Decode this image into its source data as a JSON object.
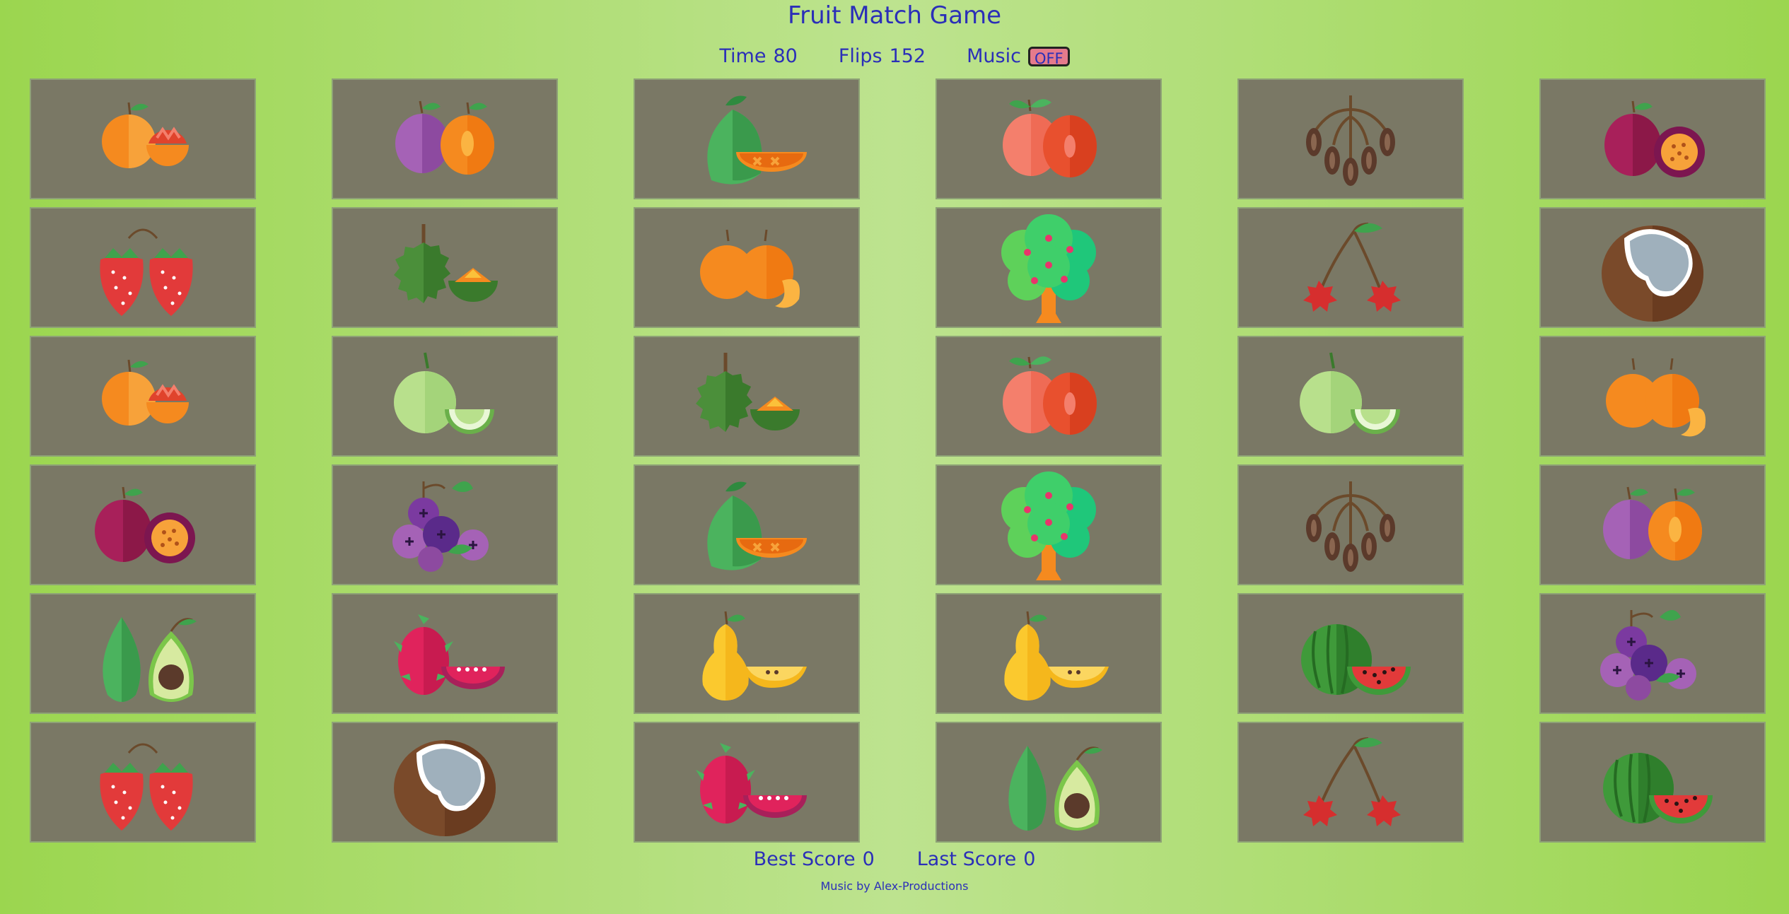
{
  "header": {
    "title": "Fruit Match Game"
  },
  "stats": {
    "time_label": "Time",
    "time_value": "80",
    "flips_label": "Flips",
    "flips_value": "152",
    "music_label": "Music",
    "music_button": "OFF"
  },
  "board": {
    "rows": [
      [
        "orange",
        "plum",
        "mango",
        "apple",
        "dates",
        "passion-fruit"
      ],
      [
        "strawberry",
        "durian",
        "tangerine",
        "fruit-tree",
        "cherry",
        "coconut"
      ],
      [
        "orange",
        "melon",
        "durian",
        "apple",
        "melon",
        "tangerine"
      ],
      [
        "passion-fruit",
        "grapes",
        "mango",
        "fruit-tree",
        "dates",
        "plum"
      ],
      [
        "avocado",
        "dragon-fruit",
        "pear",
        "pear",
        "watermelon",
        "grapes"
      ],
      [
        "strawberry",
        "coconut",
        "dragon-fruit",
        "avocado",
        "cherry",
        "watermelon"
      ]
    ]
  },
  "footer": {
    "best_label": "Best Score",
    "best_value": "0",
    "last_label": "Last Score",
    "last_value": "0",
    "credit": "Music by Alex-Productions"
  },
  "colors": {
    "background": "#bde38f",
    "card": "#7a7865",
    "text": "#2b2fb8",
    "music_button": "#e57a8c"
  }
}
